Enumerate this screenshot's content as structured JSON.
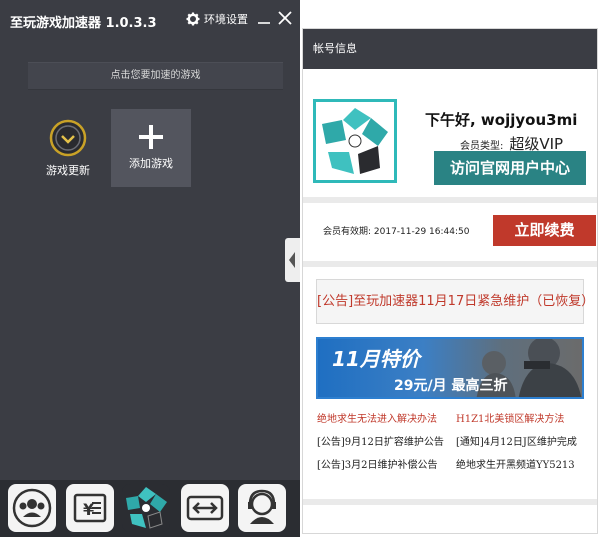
{
  "app": {
    "title": "至玩游戏加速器 1.0.3.3",
    "settings_label": "环境设置",
    "subtitle": "点击您要加速的游戏",
    "tiles": {
      "update_label": "游戏更新",
      "add_label": "添加游戏"
    },
    "bottom_icons": [
      "users-icon",
      "recharge-icon",
      "brand-logo-icon",
      "expand-icon",
      "support-icon"
    ],
    "colors": {
      "panel_bg": "#3b3d44",
      "accent_teal": "#2fb9b9",
      "accent_red": "#c0392b"
    }
  },
  "account": {
    "header": "帐号信息",
    "greeting": "下午好, wojjyou3mi",
    "member_type_label": "会员类型:",
    "member_type_value": "超级VIP",
    "visit_button": "访问官网用户中心",
    "expiry_label": "会员有效期: 2017-11-29 16:44:50",
    "renew_button": "立即续费"
  },
  "notices": {
    "featured": "[公告]至玩加速器11月17日紧急维护（已恢复）",
    "banner_title": "11月特价",
    "banner_sub": "29元/月 最高三折",
    "links": [
      {
        "text": "绝地求生无法进入解决办法",
        "color": "red"
      },
      {
        "text": "H1Z1北美锁区解决方法",
        "color": "red"
      },
      {
        "text": "[公告]9月12日扩容维护公告",
        "color": "dark"
      },
      {
        "text": "[通知]4月12日J区维护完成",
        "color": "dark"
      },
      {
        "text": "[公告]3月2日维护补偿公告",
        "color": "dark"
      },
      {
        "text": "绝地求生开黑频道YY5213",
        "color": "dark"
      }
    ]
  }
}
